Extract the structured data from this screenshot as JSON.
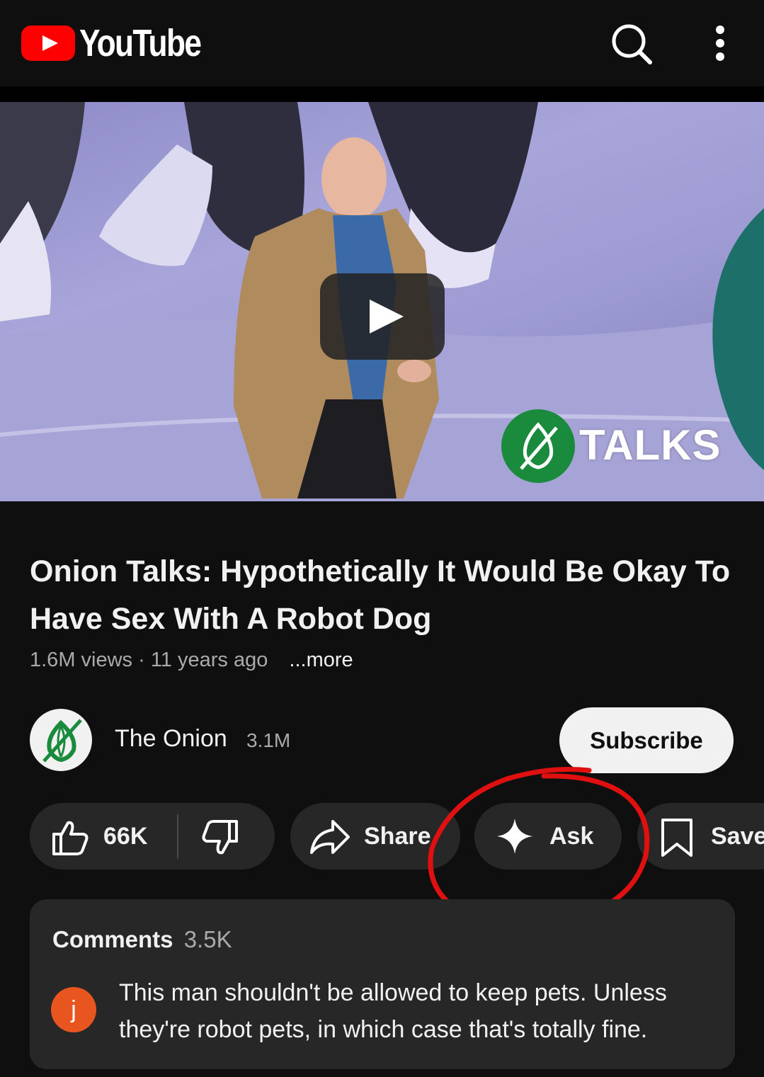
{
  "header": {
    "logo_text": "YouTube"
  },
  "video": {
    "title": "Onion Talks: Hypothetically It Would Be Okay To Have Sex With A Robot Dog",
    "views": "1.6M views",
    "age": "11 years ago",
    "more_label": "...more",
    "thumbnail_overlay_text": "TALKS"
  },
  "channel": {
    "name": "The Onion",
    "subscribers": "3.1M",
    "subscribe_label": "Subscribe"
  },
  "actions": {
    "likes": "66K",
    "share_label": "Share",
    "ask_label": "Ask",
    "save_label": "Save"
  },
  "comments": {
    "title": "Comments",
    "count": "3.5K",
    "top_comment": {
      "avatar_letter": "j",
      "text": "This man shouldn't be allowed to keep pets. Unless they're robot pets, in which case that's totally fine."
    }
  },
  "colors": {
    "brand_red": "#ff0000",
    "annotation_red": "#e01010",
    "onion_green": "#1a8a3c",
    "avatar_orange": "#e8551f"
  }
}
